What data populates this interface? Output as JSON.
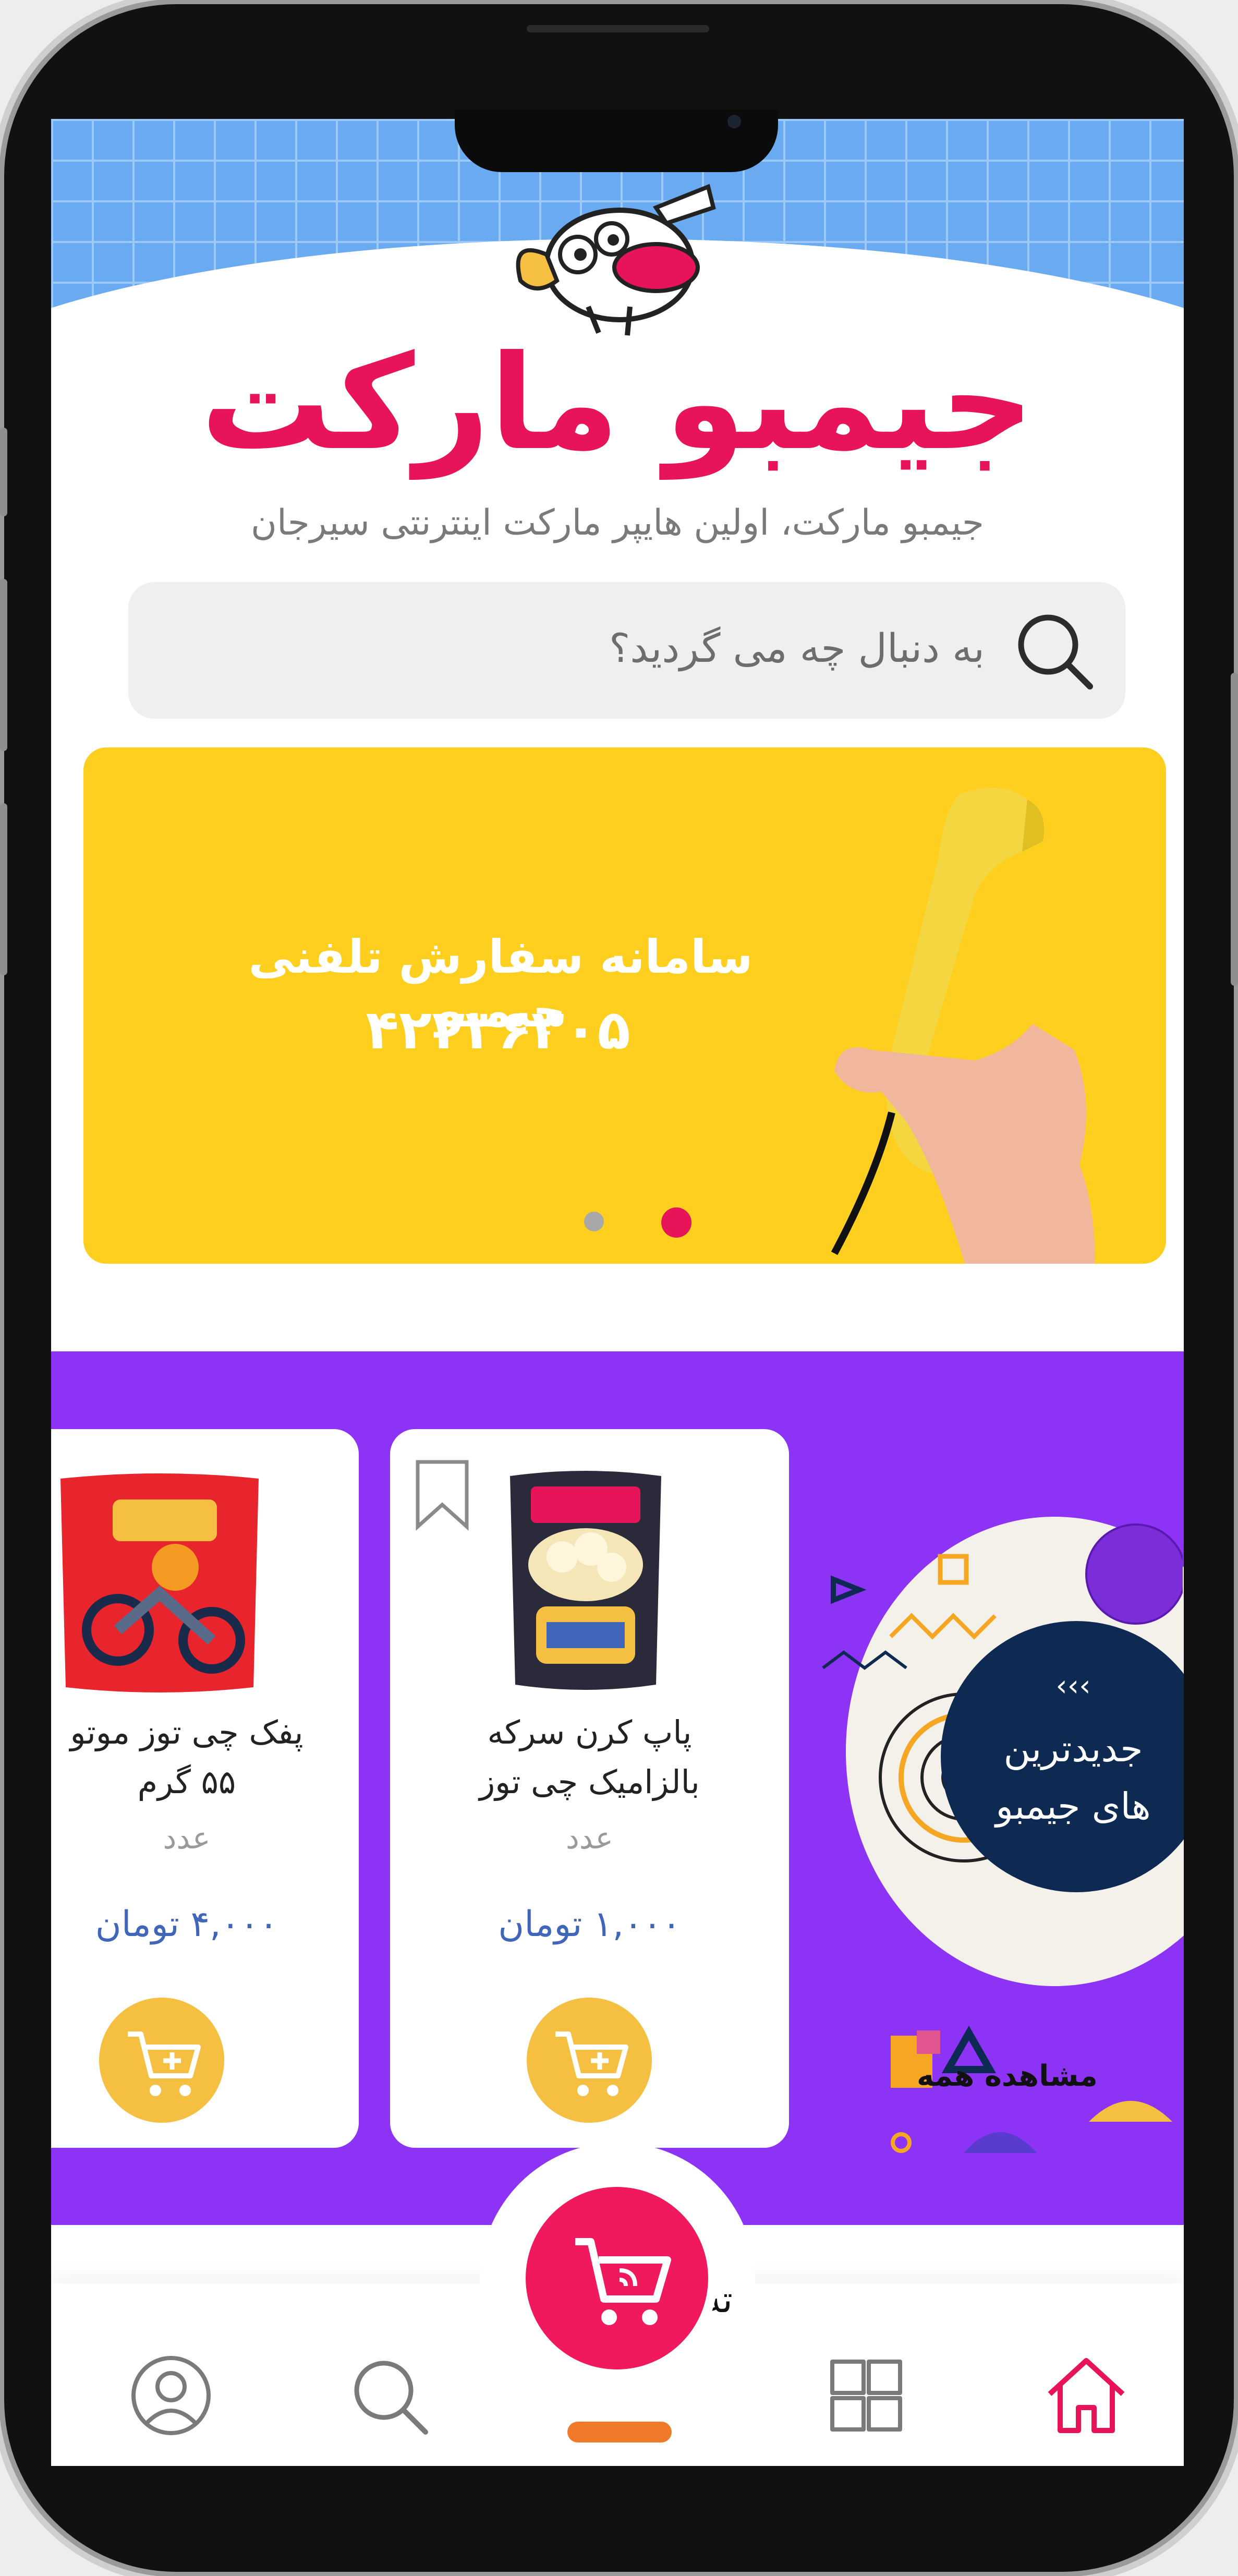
{
  "brand": {
    "name": "جیمبو مارکت",
    "tagline": "جیمبو مارکت، اولین هایپر مارکت اینترنتی سیرجان"
  },
  "search": {
    "placeholder": "به دنبال چه می گردید؟",
    "icon": "search-icon"
  },
  "banner": {
    "title": "سامانه سفارش تلفنی جیمبو",
    "phone": "۴۲۲۳۶۳۰۵",
    "slides_total": 2,
    "active_slide": 2
  },
  "promo": {
    "heading_arrows": "‹‹‹",
    "heading_line1": "جدیدترین",
    "heading_line2": "های جیمبو",
    "see_all": "مشاهده همه",
    "background_color": "#8c33f5"
  },
  "products": [
    {
      "name_line1": "پاپ کرن سرکه",
      "name_line2": "بالزامیک چی توز",
      "unit": "عدد",
      "price": "۱,۰۰۰ تومان",
      "bookmark_icon": "bookmark-icon"
    },
    {
      "name_line1": "پفک چی توز موتو",
      "name_line2": "۵۵ گرم",
      "unit": "عدد",
      "price": "۴,۰۰۰ تومان"
    }
  ],
  "bottom_nav": {
    "peek_text": "ته",
    "items": [
      "home-icon",
      "categories-icon",
      "cart-icon",
      "search-icon",
      "profile-icon"
    ],
    "active": "home-icon"
  },
  "colors": {
    "brand_pink": "#e8145a",
    "banner_yellow": "#ffcf20",
    "price_blue": "#3f66b8",
    "cart_button": "#f5c042"
  }
}
